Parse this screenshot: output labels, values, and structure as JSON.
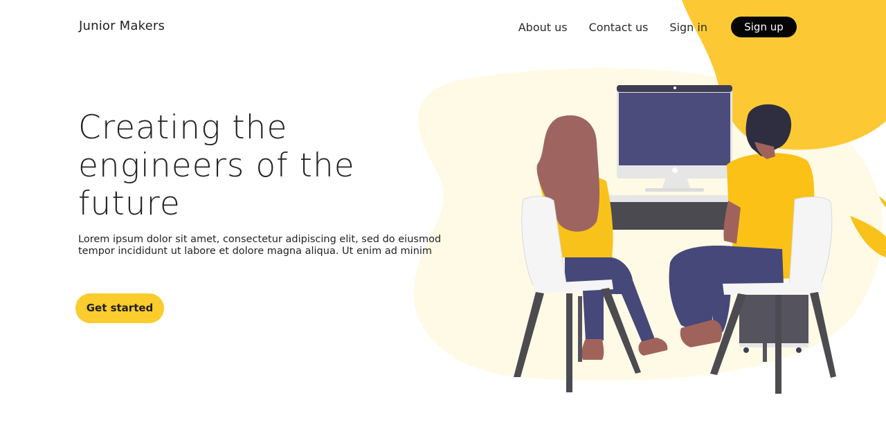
{
  "header": {
    "brand": "Junior Makers",
    "nav": {
      "about": "About us",
      "contact": "Contact us",
      "signin": "Sign in",
      "signup": "Sign up"
    }
  },
  "hero": {
    "title": "Creating the engineers of the future",
    "description": "Lorem ipsum dolor sit amet, consectetur adipiscing elit, sed do eiusmod tempor incididunt ut labore et dolore magna aliqua. Ut enim ad minim",
    "cta": "Get started"
  },
  "colors": {
    "accent": "#fbcc2d",
    "dark": "#050505",
    "blob_light": "#fffae6",
    "blob_yellow": "#fcc934"
  },
  "illustration": {
    "subject": "two-people-at-computer"
  }
}
